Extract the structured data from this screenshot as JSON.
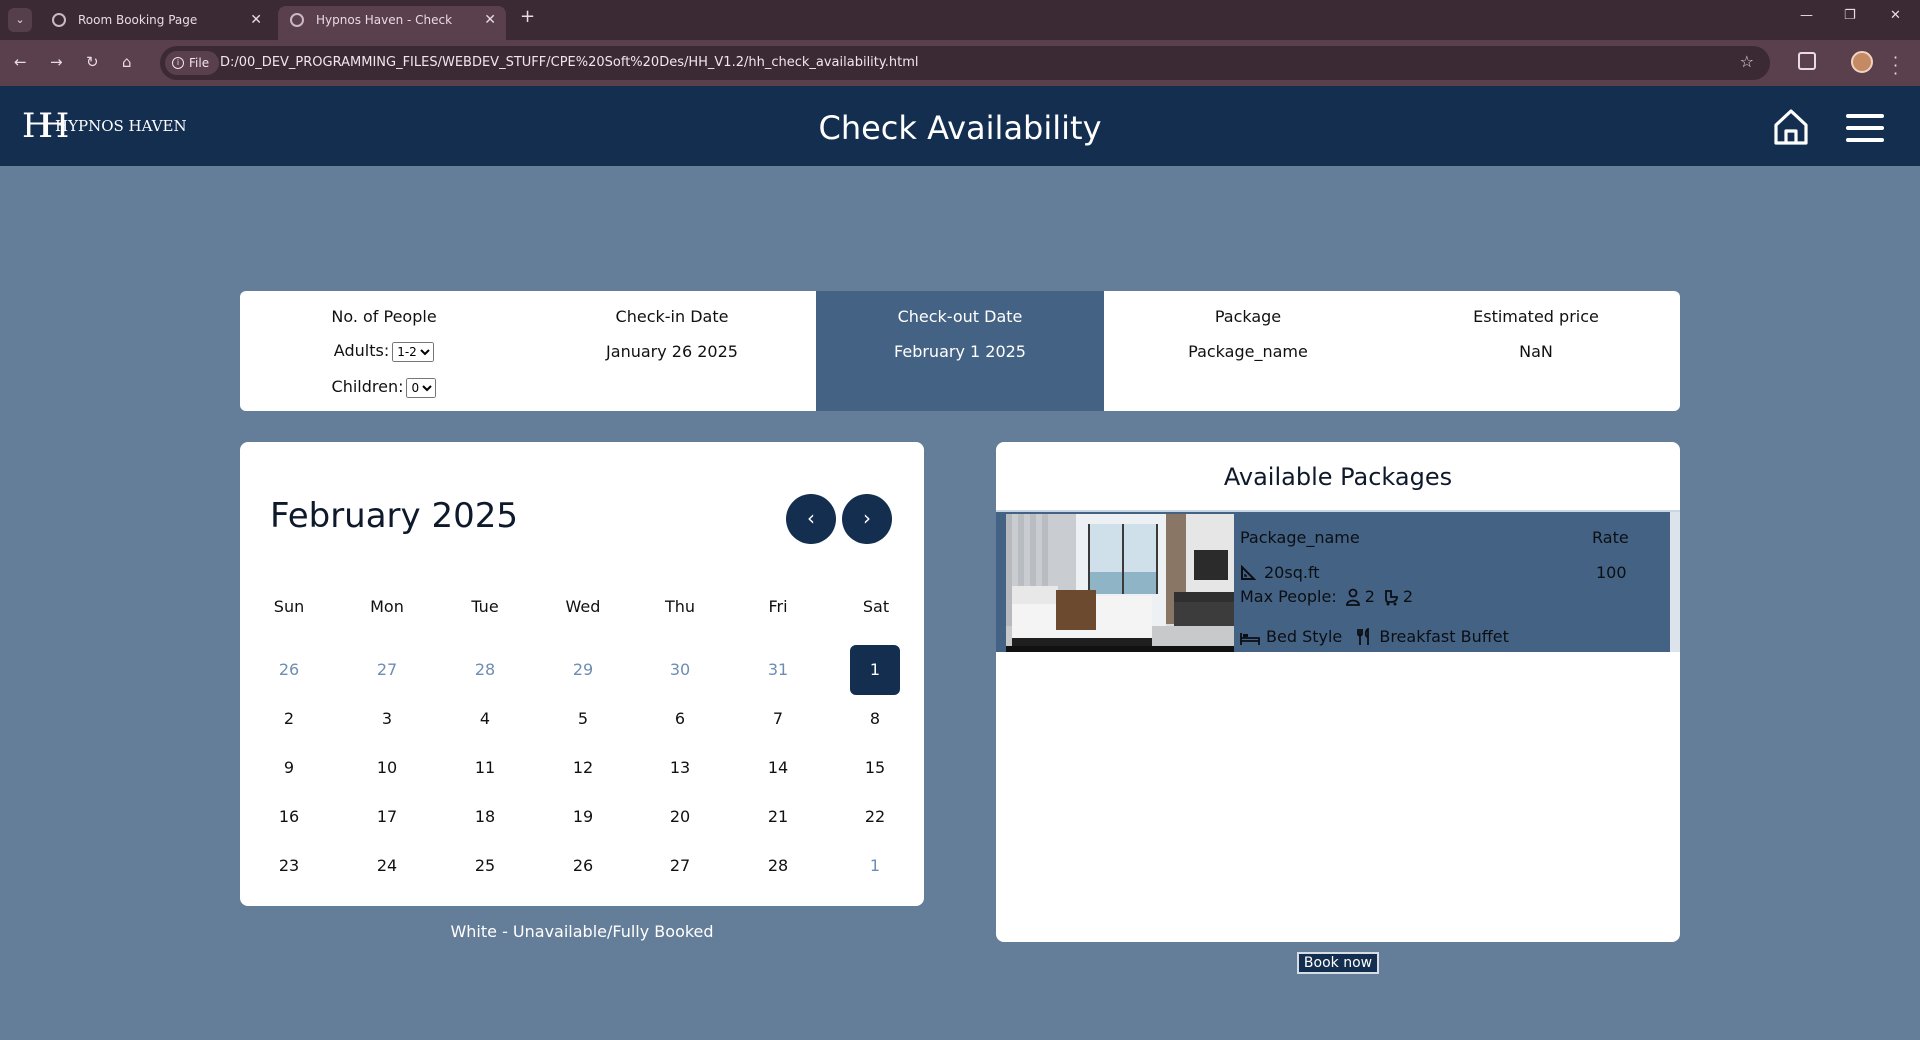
{
  "browser": {
    "tabs": [
      {
        "title": "Room Booking Page"
      },
      {
        "title": "Hypnos Haven - Check Availabili"
      }
    ],
    "file_chip": "File",
    "url": "D:/00_DEV_PROGRAMMING_FILES/WEBDEV_STUFF/CPE%20Soft%20Des/HH_V1.2/hh_check_availability.html"
  },
  "header": {
    "logo_mark": "HH",
    "logo_text": "HYPNOS HAVEN",
    "title": "Check Availability"
  },
  "summary": {
    "people_label": "No. of People",
    "adults_label": "Adults:",
    "adults_value": "1-2",
    "children_label": "Children:",
    "children_value": "0",
    "checkin_label": "Check-in Date",
    "checkin_value": "January 26 2025",
    "checkout_label": "Check-out Date",
    "checkout_value": "February 1 2025",
    "package_label": "Package",
    "package_value": "Package_name",
    "price_label": "Estimated price",
    "price_value": "NaN"
  },
  "calendar": {
    "title": "February 2025",
    "days_of_week": [
      "Sun",
      "Mon",
      "Tue",
      "Wed",
      "Thu",
      "Fri",
      "Sat"
    ],
    "weeks": [
      [
        "26",
        "27",
        "28",
        "29",
        "30",
        "31",
        "1"
      ],
      [
        "2",
        "3",
        "4",
        "5",
        "6",
        "7",
        "8"
      ],
      [
        "9",
        "10",
        "11",
        "12",
        "13",
        "14",
        "15"
      ],
      [
        "16",
        "17",
        "18",
        "19",
        "20",
        "21",
        "22"
      ],
      [
        "23",
        "24",
        "25",
        "26",
        "27",
        "28",
        "1"
      ]
    ],
    "selected_day": "1",
    "legend": "White - Unavailable/Fully Booked"
  },
  "packages": {
    "title": "Available Packages",
    "items": [
      {
        "name": "Package_name",
        "rate_label": "Rate",
        "rate": "100",
        "size": "20sq.ft",
        "max_people_label": "Max People:",
        "adults": "2",
        "children": "2",
        "bed": "Bed Style",
        "meal": "Breakfast Buffet"
      }
    ],
    "book_label": "Book now"
  },
  "colors": {
    "page_bg": "#647d98",
    "header_bg": "#142e4f",
    "active_cell": "#446283",
    "muted_day": "#6d8db2"
  }
}
